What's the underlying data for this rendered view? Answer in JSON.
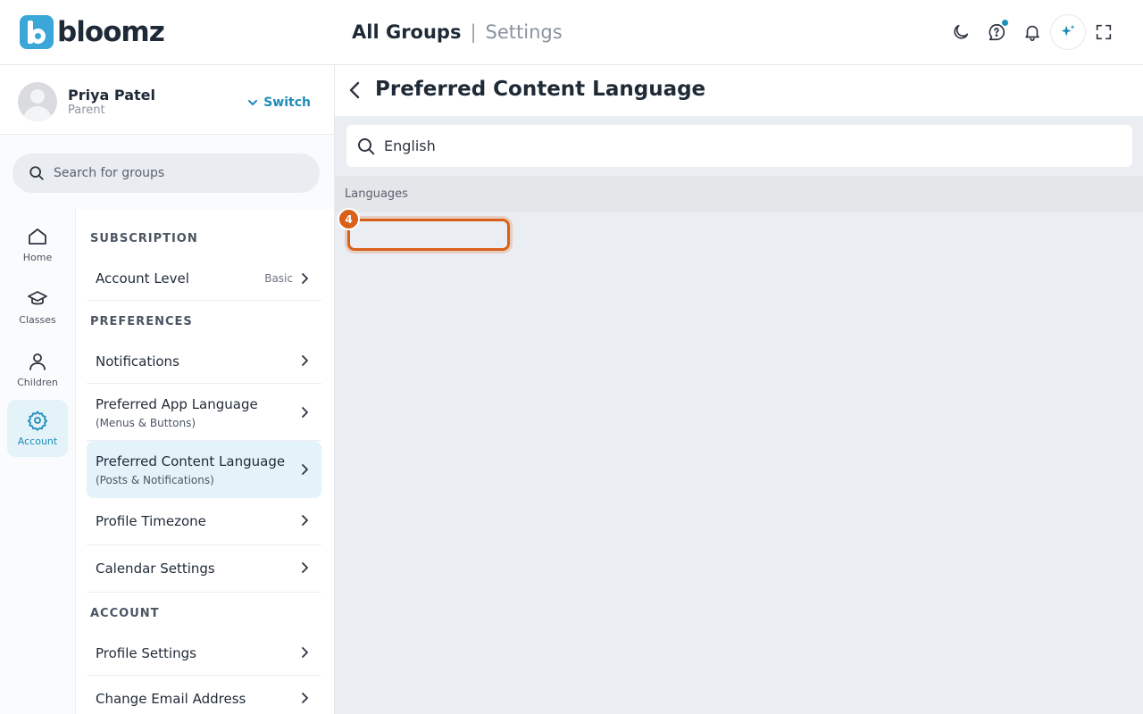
{
  "app": {
    "logo_text": "bloomz"
  },
  "breadcrumb": {
    "main": "All Groups",
    "separator": "|",
    "sub": "Settings"
  },
  "topbar_icons": [
    "moon-icon",
    "help-bubble-icon",
    "bell-icon",
    "sparkle-ai-icon",
    "fullscreen-icon"
  ],
  "user": {
    "name": "Priya Patel",
    "role": "Parent",
    "switch_label": "Switch"
  },
  "sidebar_search": {
    "placeholder": "Search for groups"
  },
  "rail": [
    {
      "label": "Home",
      "icon": "home-icon"
    },
    {
      "label": "Classes",
      "icon": "graduation-cap-icon"
    },
    {
      "label": "Children",
      "icon": "person-icon"
    },
    {
      "label": "Account",
      "icon": "gear-icon",
      "active": true
    }
  ],
  "menu": {
    "subscription_title": "SUBSCRIPTION",
    "account_level": {
      "label": "Account Level",
      "badge": "Basic"
    },
    "preferences_title": "PREFERENCES",
    "notifications": {
      "label": "Notifications"
    },
    "app_language": {
      "label": "Preferred App Language",
      "sub": "(Menus & Buttons)"
    },
    "content_language": {
      "label": "Preferred Content Language",
      "sub": "(Posts & Notifications)",
      "active": true
    },
    "timezone": {
      "label": "Profile Timezone"
    },
    "calendar": {
      "label": "Calendar Settings"
    },
    "account_title": "ACCOUNT",
    "profile_settings": {
      "label": "Profile Settings"
    },
    "change_email": {
      "label": "Change Email Address"
    }
  },
  "main": {
    "title": "Preferred Content Language",
    "search_value": "English",
    "list_header": "Languages",
    "step_number": "4"
  },
  "colors": {
    "accent": "#1f8cb7",
    "highlight": "#d9601a",
    "main_bg": "#eaedf2"
  }
}
